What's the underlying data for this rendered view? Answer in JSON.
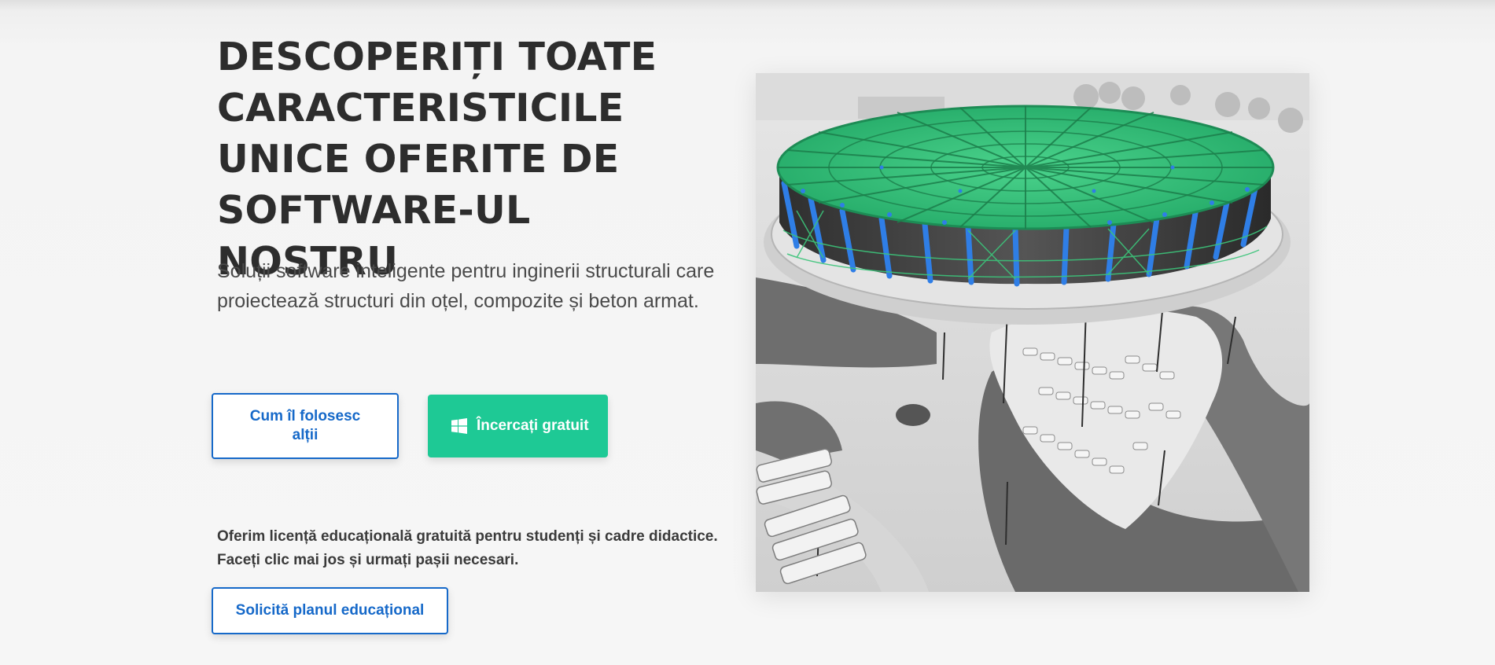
{
  "hero": {
    "title": "DESCOPERIȚI TOATE CARACTERISTICILE UNICE OFERITE DE SOFTWARE-UL NOSTRU",
    "subtitle": "Soluții software inteligente pentru inginerii structurali care proiectează structuri din oțel, compozite și beton armat."
  },
  "buttons": {
    "how_label": "Cum îl folosesc alții",
    "try_label": "Încercați gratuit",
    "try_icon": "windows-icon"
  },
  "education": {
    "text": "Oferim licență educațională gratuită pentru studenți și cadre didactice. Faceți clic mai jos și urmați pașii necesari.",
    "button_label": "Solicită planul educațional"
  },
  "image": {
    "alt_semantic": "stadium-structure-render"
  },
  "colors": {
    "accent_blue": "#1669c9",
    "accent_green": "#1ec995",
    "title_text": "#2d2d2d",
    "roof_structure": "#3cc47a",
    "columns": "#2f7ee6"
  }
}
